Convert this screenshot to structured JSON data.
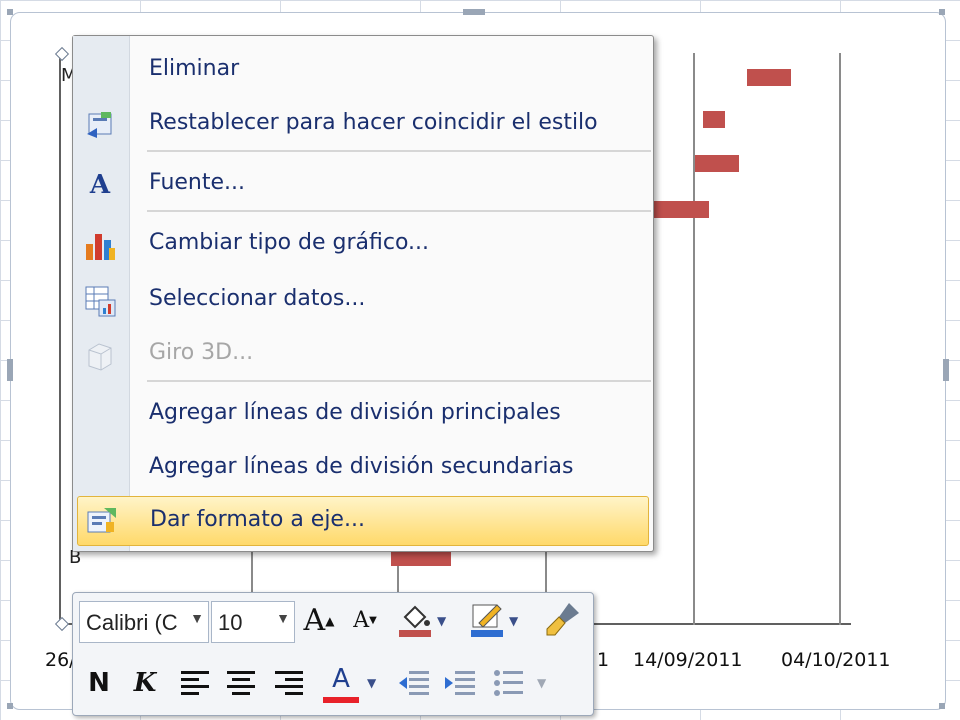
{
  "sheet": {
    "cell_fragment": ""
  },
  "chart": {
    "x_ticks": [
      "26/",
      "1",
      "14/09/2011",
      "04/10/2011"
    ],
    "category_fragments": [
      "M",
      "B"
    ],
    "bar_color": "#c0504d"
  },
  "context_menu": {
    "items": [
      {
        "label": "Eliminar",
        "icon": "none"
      },
      {
        "label": "Restablecer para hacer coincidir el estilo",
        "icon": "reset-style-icon"
      },
      {
        "label": "Fuente...",
        "icon": "font-icon"
      },
      {
        "label": "Cambiar tipo de gráfico...",
        "icon": "chart-type-icon"
      },
      {
        "label": "Seleccionar datos...",
        "icon": "select-data-icon"
      },
      {
        "label": "Giro 3D...",
        "icon": "3d-rotation-icon",
        "disabled": true
      },
      {
        "label": "Agregar líneas de división principales",
        "icon": "none"
      },
      {
        "label": "Agregar líneas de división secundarias",
        "icon": "none"
      },
      {
        "label": "Dar formato a eje...",
        "icon": "format-axis-icon",
        "highlighted": true
      }
    ]
  },
  "mini_toolbar": {
    "font_name": "Calibri (C",
    "font_size": "10",
    "bold_label": "N",
    "italic_label": "K",
    "font_color_label": "A",
    "grow_font_label": "A",
    "shrink_font_label": "A",
    "fill_color": "#c0504d",
    "line_color": "#2e6dd1",
    "font_color": "#e8212a"
  }
}
